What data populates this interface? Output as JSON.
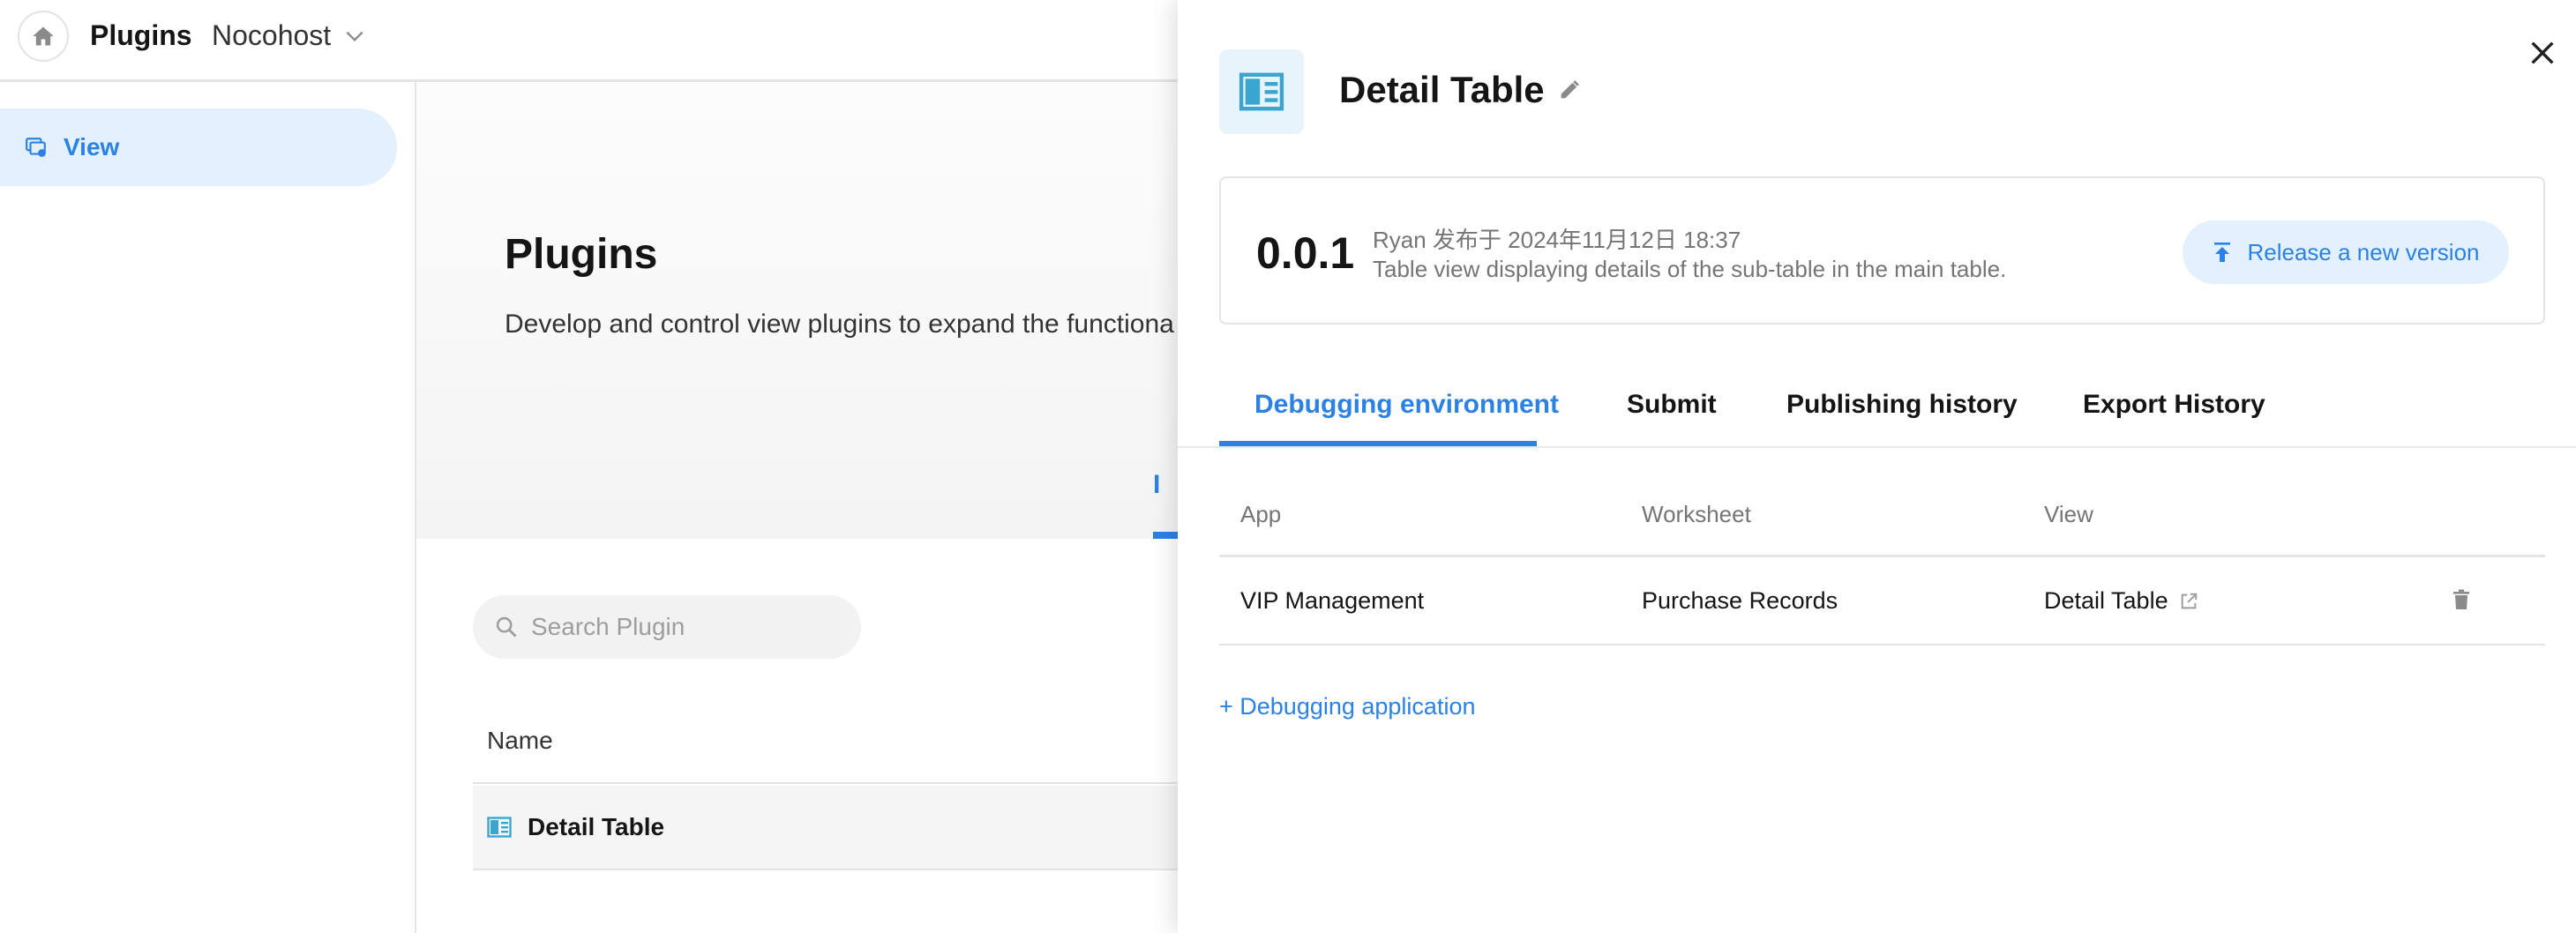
{
  "topbar": {
    "app_title": "Plugins",
    "org_name": "Nocohost"
  },
  "sidebar": {
    "items": [
      {
        "label": "View",
        "icon": "view-icon",
        "active": true
      }
    ]
  },
  "main": {
    "title": "Plugins",
    "description": "Develop and control view plugins to expand the functiona",
    "tab_peek": "I",
    "search": {
      "placeholder": "Search Plugin",
      "value": ""
    },
    "list": {
      "header_name": "Name",
      "rows": [
        {
          "name": "Detail Table"
        }
      ]
    }
  },
  "drawer": {
    "title": "Detail Table",
    "version": {
      "number": "0.0.1",
      "meta": "Ryan 发布于 2024年11月12日 18:37",
      "description": "Table view displaying details of the sub-table in the main table.",
      "release_button": "Release a new version"
    },
    "tabs": [
      {
        "label": "Debugging environment",
        "active": true
      },
      {
        "label": "Submit",
        "active": false
      },
      {
        "label": "Publishing history",
        "active": false
      },
      {
        "label": "Export History",
        "active": false
      }
    ],
    "table": {
      "columns": [
        "App",
        "Worksheet",
        "View"
      ],
      "rows": [
        {
          "app": "VIP Management",
          "worksheet": "Purchase Records",
          "view": "Detail Table"
        }
      ]
    },
    "add_link": "+ Debugging application"
  },
  "colors": {
    "accent": "#2b82e4",
    "accent_light": "#e3f0fd",
    "plugin_icon": "#3aa6d0",
    "text_secondary": "#757575"
  }
}
